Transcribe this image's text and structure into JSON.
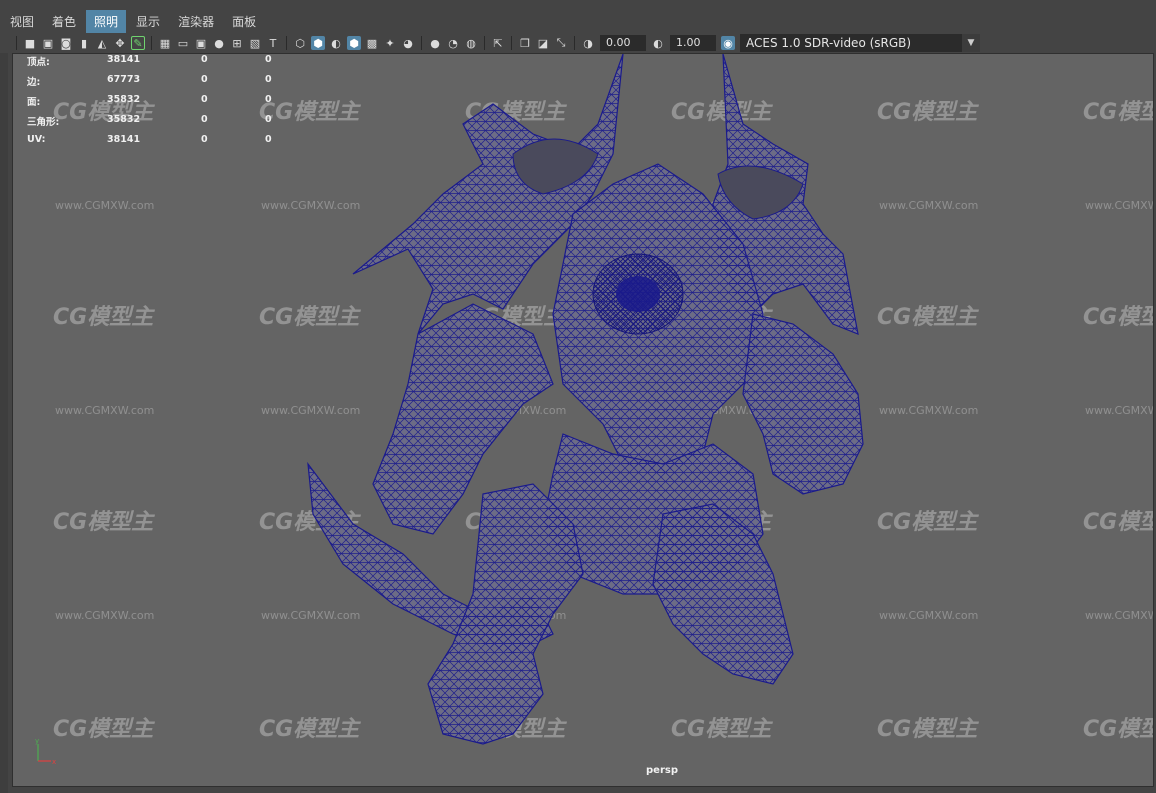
{
  "menu": [
    "视图",
    "着色",
    "照明",
    "显示",
    "渲染器",
    "面板"
  ],
  "active_menu_index": 2,
  "toolbar": {
    "icons_group1": [
      "camera-select-icon",
      "camera-attribute-icon",
      "bookmark-icon",
      "image-plane-icon",
      "2d-pan-zoom-icon",
      "grease-pencil-icon"
    ],
    "icons_group2": [
      "grid-icon",
      "film-gate-icon",
      "resolution-gate-icon",
      "gate-mask-icon",
      "field-chart-icon",
      "safe-action-icon",
      "safe-title-icon"
    ],
    "icons_group3": [
      "wireframe-icon",
      "smooth-shade-icon",
      "use-default-material-icon",
      "wireframe-on-shaded-icon",
      "xray-icon",
      "use-all-lights-icon",
      "shadows-icon"
    ],
    "icons_group4": [
      "screen-space-ao-icon",
      "motion-blur-icon",
      "multisample-aa-icon",
      "depth-of-field-icon"
    ],
    "icons_group5": [
      "isolate-select-icon",
      "xray-joints-icon",
      "xray-active-icon",
      "toggle-hud-icon"
    ],
    "exposure_value": "0.00",
    "gamma_value": "1.00",
    "color_space": "ACES 1.0 SDR-video (sRGB)"
  },
  "stats": [
    {
      "label": "顶点:",
      "v1": "38141",
      "v2": "0",
      "v3": "0"
    },
    {
      "label": "边:",
      "v1": "67773",
      "v2": "0",
      "v3": "0"
    },
    {
      "label": "面:",
      "v1": "35832",
      "v2": "0",
      "v3": "0"
    },
    {
      "label": "三角形:",
      "v1": "35832",
      "v2": "0",
      "v3": "0"
    },
    {
      "label": "UV:",
      "v1": "38141",
      "v2": "0",
      "v3": "0"
    }
  ],
  "watermark": {
    "logo": "CG模型主",
    "url": "www.CGMXW.com"
  },
  "camera_label": "persp",
  "colors": {
    "wire": "#1a1a8c",
    "viewport_bg": "#646464",
    "active_menu": "#5285a6"
  }
}
